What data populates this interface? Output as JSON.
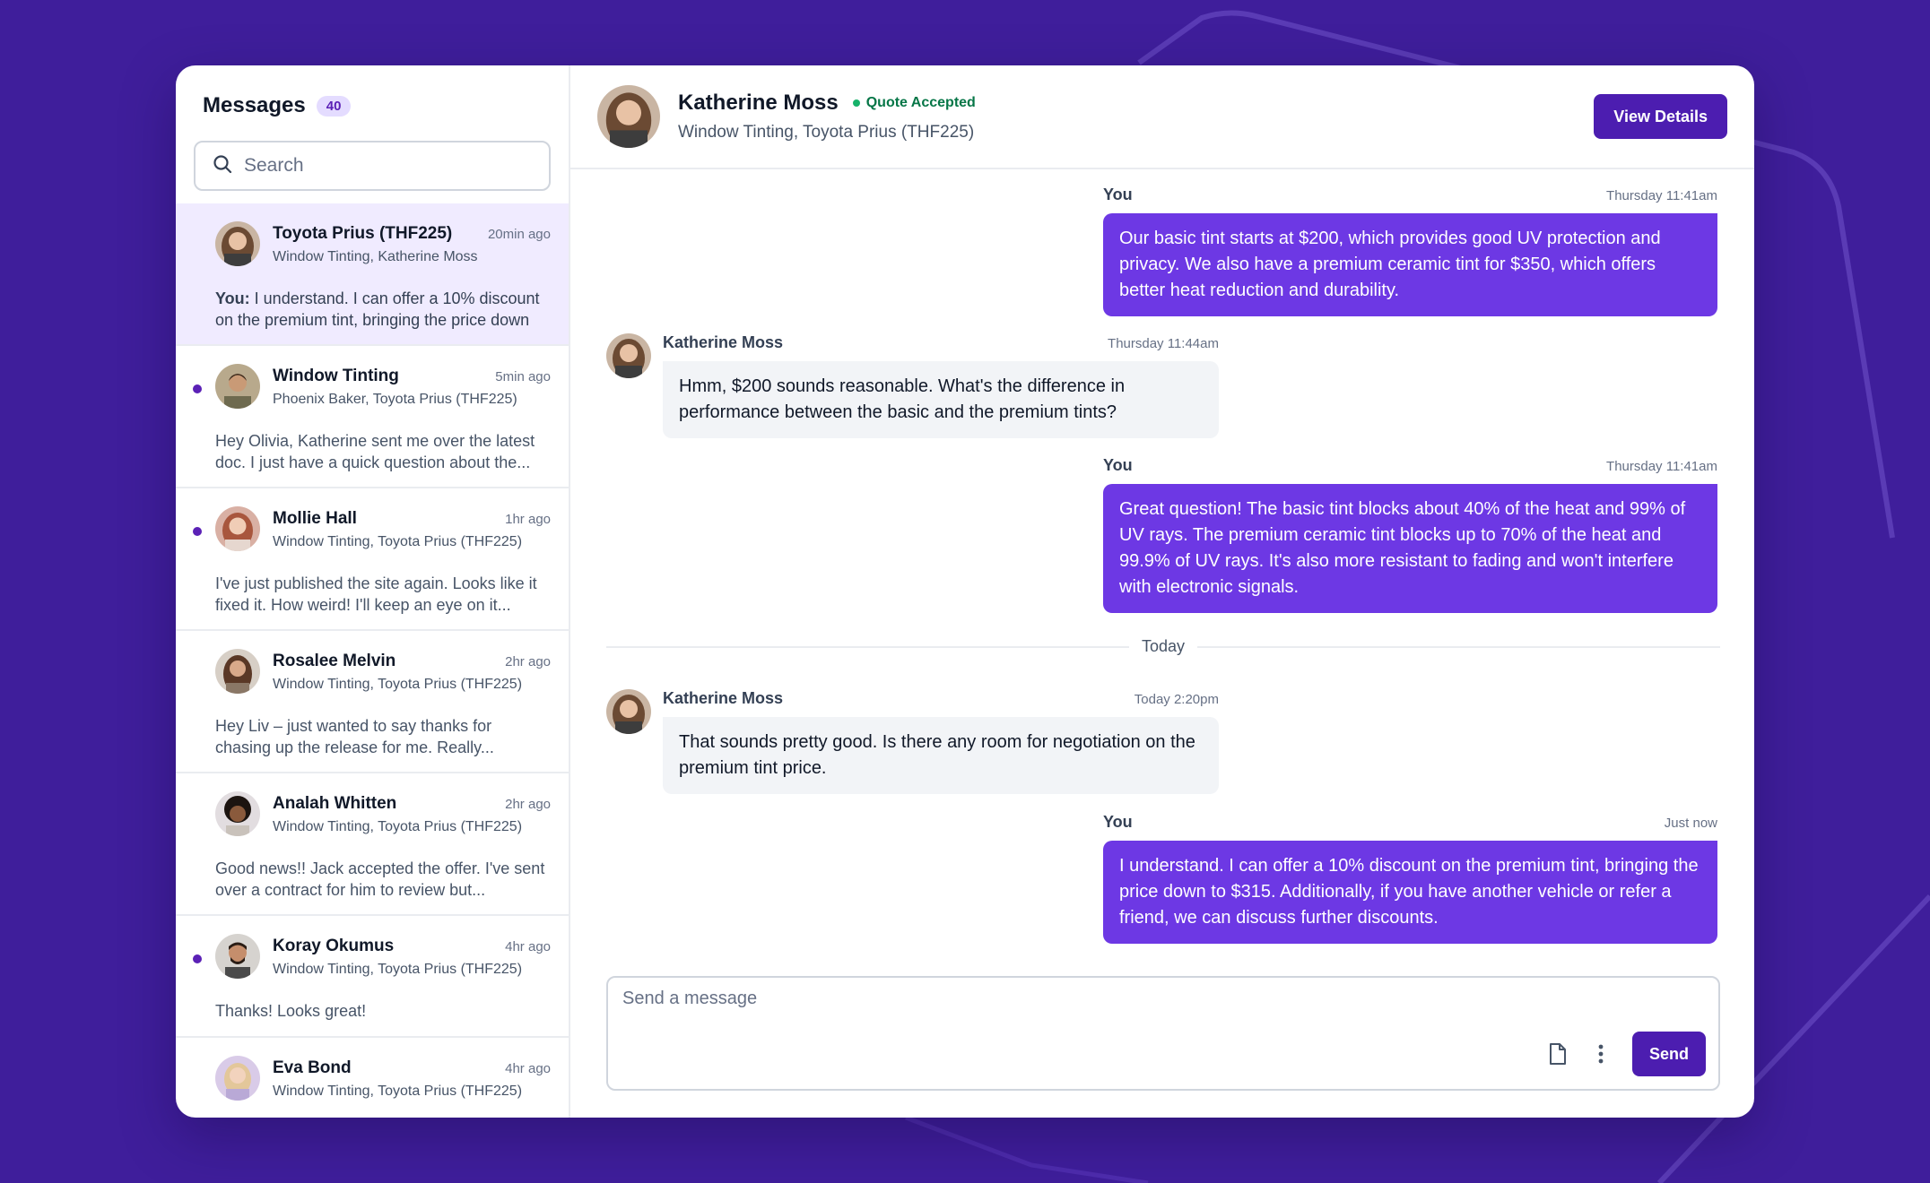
{
  "colors": {
    "background": "#3f1e9b",
    "accent": "#4c1db0",
    "outgoing_bubble": "#6d38e4",
    "incoming_bubble": "#f2f4f7",
    "active_row": "#f0ebff",
    "status_green": "#17b26a"
  },
  "sidebar": {
    "title": "Messages",
    "count": "40",
    "search_placeholder": "Search",
    "conversations": [
      {
        "name": "Toyota Prius (THF225)",
        "time": "20min ago",
        "subtitle": "Window Tinting, Katherine Moss",
        "preview_prefix": "You:",
        "preview": "I understand. I can offer a 10% discount on the premium tint, bringing the price down to...",
        "unread": false,
        "active": true
      },
      {
        "name": "Window Tinting",
        "time": "5min ago",
        "subtitle": "Phoenix Baker, Toyota Prius (THF225)",
        "preview": "Hey Olivia, Katherine sent me over the latest doc. I just have a quick question about the...",
        "unread": true
      },
      {
        "name": "Mollie Hall",
        "time": "1hr ago",
        "subtitle": "Window Tinting, Toyota Prius (THF225)",
        "preview": "I've just published the site again. Looks like it fixed it. How weird! I'll keep an eye on it...",
        "unread": true
      },
      {
        "name": "Rosalee Melvin",
        "time": "2hr ago",
        "subtitle": "Window Tinting, Toyota Prius (THF225)",
        "preview": "Hey Liv – just wanted to say thanks for chasing up the release for me. Really...",
        "unread": false
      },
      {
        "name": "Analah Whitten",
        "time": "2hr ago",
        "subtitle": "Window Tinting, Toyota Prius (THF225)",
        "preview": "Good news!! Jack accepted the offer. I've sent over a contract for him to review but...",
        "unread": false
      },
      {
        "name": "Koray Okumus",
        "time": "4hr ago",
        "subtitle": "Window Tinting, Toyota Prius (THF225)",
        "preview": "Thanks! Looks great!",
        "unread": true
      },
      {
        "name": "Eva Bond",
        "time": "4hr ago",
        "subtitle": "Window Tinting, Toyota Prius (THF225)",
        "preview": "",
        "unread": false
      }
    ]
  },
  "header": {
    "name": "Katherine Moss",
    "status": "Quote Accepted",
    "subtitle": "Window Tinting, Toyota Prius (THF225)",
    "view_details_label": "View Details"
  },
  "messages": [
    {
      "sender": "You",
      "time": "Thursday 11:41am",
      "text": "Our basic tint starts at $200, which provides good UV protection and privacy. We also have a premium ceramic tint for $350, which offers better heat reduction and durability.",
      "outgoing": true
    },
    {
      "sender": "Katherine Moss",
      "time": "Thursday 11:44am",
      "text": "Hmm, $200 sounds reasonable. What's the difference in performance between the basic and the premium tints?",
      "outgoing": false
    },
    {
      "sender": "You",
      "time": "Thursday 11:41am",
      "text": "Great question! The basic tint blocks about 40% of the heat and 99% of UV rays. The premium ceramic tint blocks up to 70% of the heat and 99.9% of UV rays. It's also more resistant to fading and won't interfere with electronic signals.",
      "outgoing": true
    },
    {
      "sender": "Katherine Moss",
      "time": "Today 2:20pm",
      "text": "That sounds pretty good. Is there any room for negotiation on the premium tint price.",
      "outgoing": false
    },
    {
      "sender": "You",
      "time": "Just now",
      "text": "I understand. I can offer a 10% discount on the premium tint, bringing the price down to $315. Additionally, if you have another vehicle or refer a friend, we can discuss further discounts.",
      "outgoing": true
    }
  ],
  "divider_label": "Today",
  "composer": {
    "placeholder": "Send a message",
    "send_label": "Send",
    "attach_icon": "file-icon",
    "more_icon": "more-vertical-icon"
  }
}
